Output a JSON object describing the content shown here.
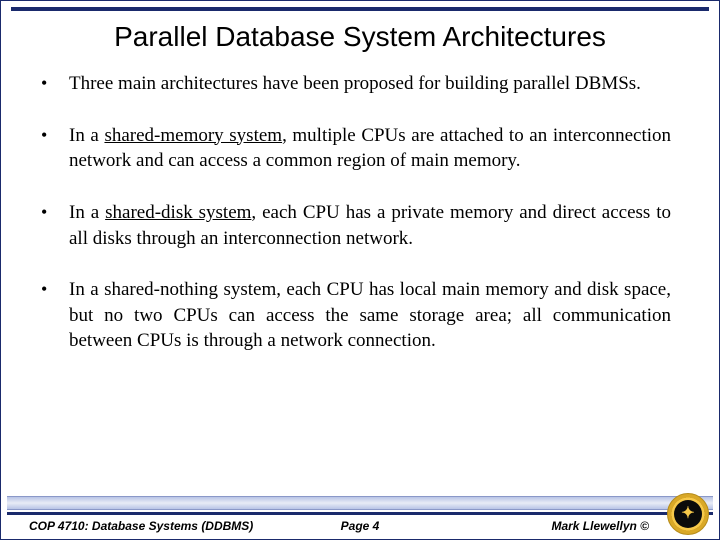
{
  "title": "Parallel Database System Architectures",
  "bullets": [
    {
      "pre": "Three main architectures have been proposed for building parallel DBMSs.",
      "u": "",
      "post": ""
    },
    {
      "pre": "In a ",
      "u": "shared-memory system",
      "post": ", multiple CPUs are attached to an interconnection network and can access a common region of main memory."
    },
    {
      "pre": "In a ",
      "u": "shared-disk system",
      "post": ", each CPU has a private memory and direct access to all disks through an interconnection network."
    },
    {
      "pre": "In a shared-nothing system, each CPU has local main memory and disk space, but no two CPUs can access the same storage area; all communication between CPUs is through a network connection.",
      "u": "",
      "post": ""
    }
  ],
  "footer": {
    "course": "COP 4710: Database Systems (DDBMS)",
    "page": "Page 4",
    "author": "Mark Llewellyn ©"
  },
  "logo_glyph": "✦"
}
